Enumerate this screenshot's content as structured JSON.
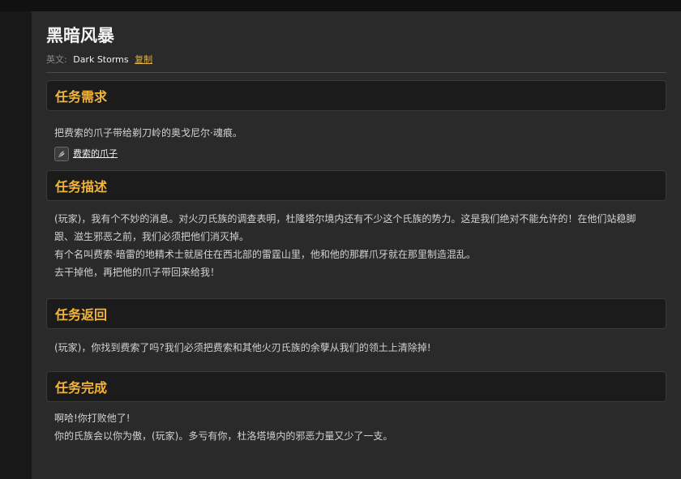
{
  "quest": {
    "title": "黑暗风暴",
    "en_label": "英文:",
    "en_name": "Dark Storms",
    "copy_label": "复制"
  },
  "sections": {
    "requirement": {
      "title": "任务需求",
      "text": "把费索的爪子带给剃刀岭的奥戈尼尔·魂痕。",
      "item_name": "费索的爪子",
      "item_icon": "claw-item-icon"
    },
    "description": {
      "title": "任务描述",
      "line1": "(玩家)，我有个不妙的消息。对火刃氏族的调查表明，杜隆塔尔境内还有不少这个氏族的势力。这是我们绝对不能允许的！在他们站稳脚",
      "line2": "跟、滋生邪恶之前，我们必须把他们消灭掉。",
      "line3": "有个名叫费索·暗雷的地精术士就居住在西北部的雷霆山里，他和他的那群爪牙就在那里制造混乱。",
      "line4": "去干掉他，再把他的爪子带回来给我！"
    },
    "return": {
      "title": "任务返回",
      "text": "(玩家)，你找到费索了吗?我们必须把费索和其他火刃氏族的余孽从我们的领土上清除掉!"
    },
    "complete": {
      "title": "任务完成",
      "line1": "啊哈!你打败他了!",
      "line2": "你的氏族会以你为傲，(玩家)。多亏有你，杜洛塔境内的邪恶力量又少了一支。"
    }
  },
  "colors": {
    "accent": "#f2b53a",
    "link": "#e0b040",
    "panel": "#2a2a2a",
    "header_bg": "#1b1b1b"
  }
}
